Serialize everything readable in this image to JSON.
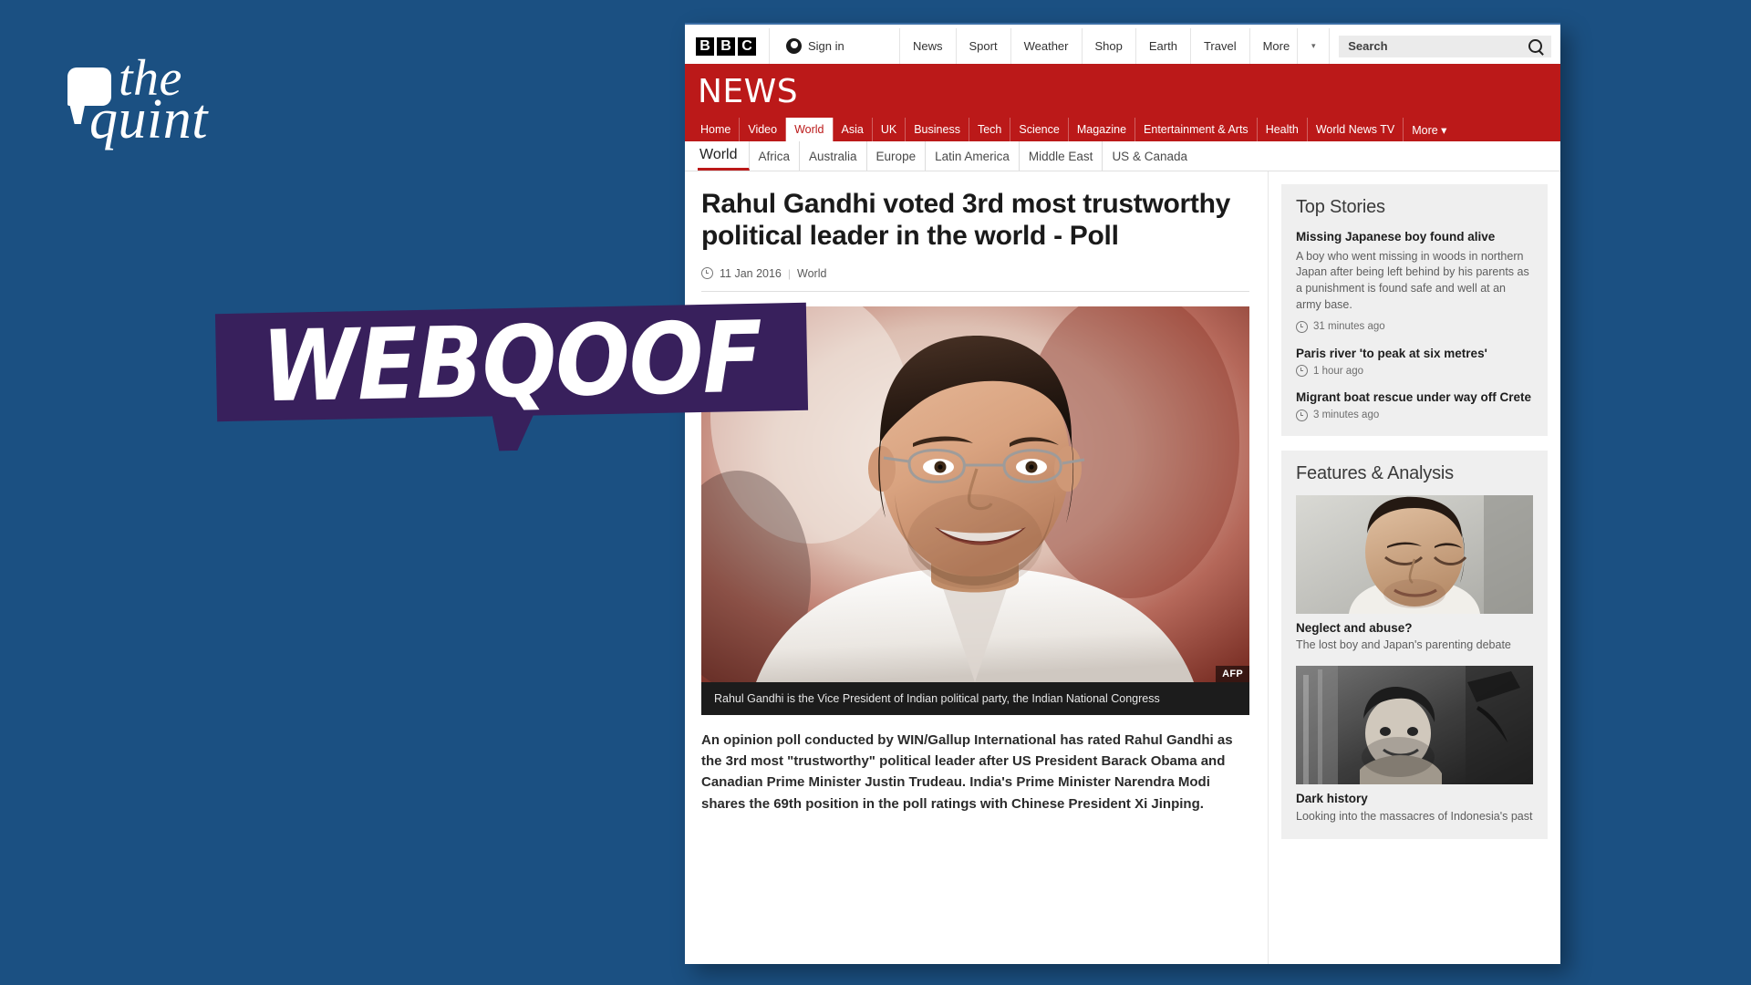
{
  "brand": {
    "name_line1": "the",
    "name_line2": "quint",
    "background_color": "#1b5082"
  },
  "watermark": {
    "label": "WEBQOOF",
    "background_color": "#38205c",
    "text_color": "#ffffff"
  },
  "bbc": {
    "logo_letters": [
      "B",
      "B",
      "C"
    ],
    "sign_in_label": "Sign in",
    "top_nav": [
      "News",
      "Sport",
      "Weather",
      "Shop",
      "Earth",
      "Travel",
      "More"
    ],
    "top_nav_caret": "▾",
    "search": {
      "placeholder": "Search",
      "value": ""
    },
    "masthead": "NEWS",
    "masthead_color": "#bb1919",
    "section_nav": [
      {
        "label": "Home",
        "active": false
      },
      {
        "label": "Video",
        "active": false
      },
      {
        "label": "World",
        "active": true
      },
      {
        "label": "Asia",
        "active": false
      },
      {
        "label": "UK",
        "active": false
      },
      {
        "label": "Business",
        "active": false
      },
      {
        "label": "Tech",
        "active": false
      },
      {
        "label": "Science",
        "active": false
      },
      {
        "label": "Magazine",
        "active": false
      },
      {
        "label": "Entertainment & Arts",
        "active": false
      },
      {
        "label": "Health",
        "active": false
      },
      {
        "label": "World News TV",
        "active": false
      },
      {
        "label": "More ▾",
        "active": false
      }
    ],
    "sub_nav": [
      {
        "label": "World",
        "active": true
      },
      {
        "label": "Africa",
        "active": false
      },
      {
        "label": "Australia",
        "active": false
      },
      {
        "label": "Europe",
        "active": false
      },
      {
        "label": "Latin America",
        "active": false
      },
      {
        "label": "Middle East",
        "active": false
      },
      {
        "label": "US & Canada",
        "active": false
      }
    ]
  },
  "article": {
    "headline": "Rahul Gandhi voted 3rd most trustworthy political leader in the world - Poll",
    "date": "11 Jan 2016",
    "separator": "|",
    "section": "World",
    "photo_credit": "AFP",
    "photo_caption": "Rahul Gandhi is the Vice President of Indian political party, the Indian National Congress",
    "intro": "An opinion poll conducted by WIN/Gallup International has rated Rahul Gandhi as the 3rd most \"trustworthy\" political leader after US President Barack Obama and Canadian Prime Minister Justin Trudeau. India's Prime Minister Narendra Modi shares the 69th position in the poll ratings with Chinese President Xi Jinping."
  },
  "sidebar": {
    "top_stories": {
      "title": "Top Stories",
      "items": [
        {
          "headline": "Missing Japanese boy found alive",
          "summary": "A boy who went missing in woods in northern Japan after being left behind by his parents as a punishment is found safe and well at an army base.",
          "time": "31 minutes ago"
        },
        {
          "headline": "Paris river 'to peak at six metres'",
          "summary": "",
          "time": "1 hour ago"
        },
        {
          "headline": "Migrant boat rescue under way off Crete",
          "summary": "",
          "time": "3 minutes ago"
        }
      ]
    },
    "features": {
      "title": "Features & Analysis",
      "items": [
        {
          "title": "Neglect and abuse?",
          "subtitle": "The lost boy and Japan's parenting debate"
        },
        {
          "title": "Dark history",
          "subtitle": "Looking into the massacres of Indonesia's past"
        }
      ]
    }
  }
}
